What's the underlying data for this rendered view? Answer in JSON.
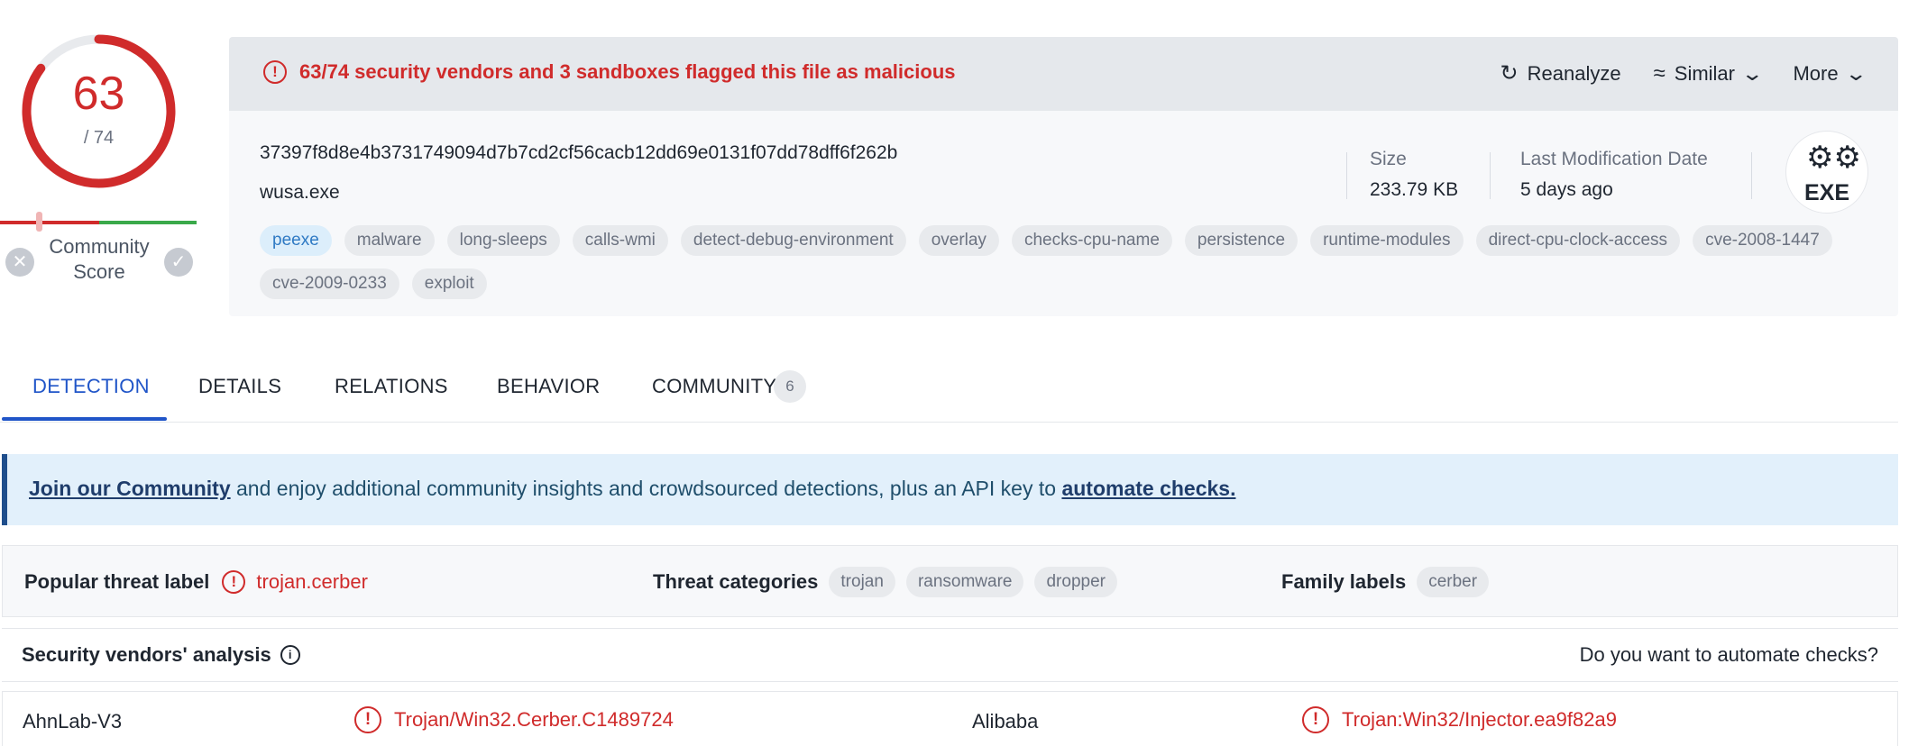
{
  "score": {
    "detected": "63",
    "total": "/ 74",
    "community_label": "Community Score"
  },
  "alert": {
    "text": "63/74 security vendors and 3 sandboxes flagged this file as malicious"
  },
  "actions": {
    "reanalyze": "Reanalyze",
    "similar": "Similar",
    "more": "More"
  },
  "file": {
    "hash": "37397f8d8e4b3731749094d7b7cd2cf56cacb12dd69e0131f07dd78dff6f262b",
    "name": "wusa.exe",
    "size_label": "Size",
    "size_value": "233.79 KB",
    "modified_label": "Last Modification Date",
    "modified_value": "5 days ago",
    "type_badge": "EXE"
  },
  "tags": [
    "peexe",
    "malware",
    "long-sleeps",
    "calls-wmi",
    "detect-debug-environment",
    "overlay",
    "checks-cpu-name",
    "persistence",
    "runtime-modules",
    "direct-cpu-clock-access",
    "cve-2008-1447",
    "cve-2009-0233",
    "exploit"
  ],
  "tabs": {
    "detection": "DETECTION",
    "details": "DETAILS",
    "relations": "RELATIONS",
    "behavior": "BEHAVIOR",
    "community": "COMMUNITY",
    "community_count": "6"
  },
  "banner": {
    "link1": "Join our Community",
    "middle": " and enjoy additional community insights and crowdsourced detections, plus an API key to ",
    "link2": "automate checks."
  },
  "threat": {
    "popular_label": "Popular threat label",
    "popular_value": "trojan.cerber",
    "categories_label": "Threat categories",
    "categories": [
      "trojan",
      "ransomware",
      "dropper"
    ],
    "family_label": "Family labels",
    "families": [
      "cerber"
    ]
  },
  "vendors": {
    "title": "Security vendors' analysis",
    "automate_prompt": "Do you want to automate checks?",
    "rows": [
      {
        "vendor_a": "AhnLab-V3",
        "result_a": "Trojan/Win32.Cerber.C1489724",
        "vendor_b": "Alibaba",
        "result_b": "Trojan:Win32/Injector.ea9f82a9"
      }
    ]
  },
  "colors": {
    "malicious": "#d02b2b",
    "accent": "#2055c8",
    "positive": "#3aa94a"
  }
}
